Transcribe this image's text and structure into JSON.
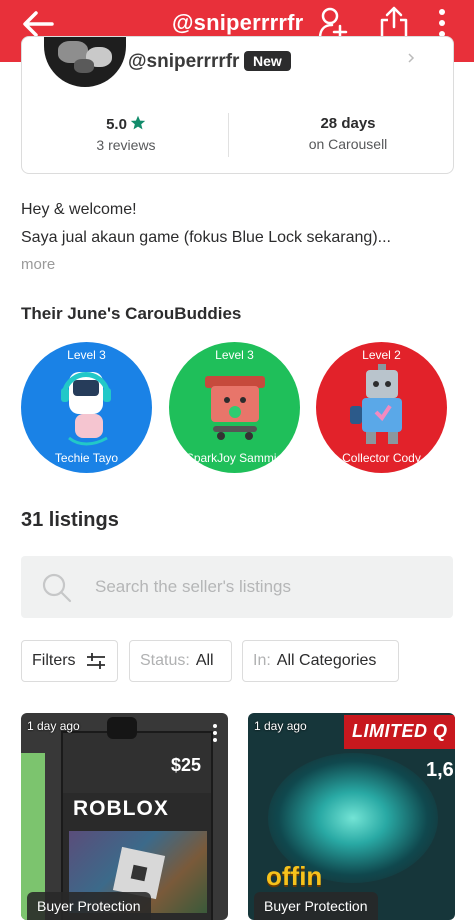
{
  "header": {
    "title": "@sniperrrrfr",
    "bg_color": "#e8303a"
  },
  "profile": {
    "username": "@sniperrrrfr",
    "badge": "New",
    "rating": "5.0",
    "reviews": "3 reviews",
    "days": "28 days",
    "days_sub": "on Carousell"
  },
  "bio": {
    "line1": "Hey & welcome!",
    "line2": "Saya jual akaun game (fokus Blue Lock sekarang)...",
    "more": "more"
  },
  "buddies": {
    "title": "Their June's CarouBuddies",
    "items": [
      {
        "level": "Level 3",
        "name": "Techie Tayo",
        "color": "#1a82e6"
      },
      {
        "level": "Level 3",
        "name": "SparkJoy Sammie",
        "color": "#1fbf5a"
      },
      {
        "level": "Level 2",
        "name": "Collector Cody",
        "color": "#e2222a"
      }
    ]
  },
  "listings": {
    "title": "31 listings",
    "search_placeholder": "Search the seller's listings",
    "filters_label": "Filters",
    "status_label": "Status:",
    "status_value": "All",
    "in_label": "In:",
    "in_value": "All Categories",
    "cards": [
      {
        "age": "1 day ago",
        "badge": "Buyer Protection",
        "art_price": "$25",
        "art_logo": "ROBLOX"
      },
      {
        "age": "1 day ago",
        "badge": "Buyer Protection",
        "art_banner": "LIMITED Q",
        "art_text": "offin",
        "art_number": "1,6"
      }
    ]
  },
  "colors": {
    "accent": "#e8303a",
    "star": "#128c6b"
  },
  "icons": [
    "back-arrow-icon",
    "add-user-icon",
    "share-icon",
    "more-vertical-icon",
    "star-icon",
    "search-icon",
    "filter-sliders-icon",
    "chevron-right-icon"
  ]
}
